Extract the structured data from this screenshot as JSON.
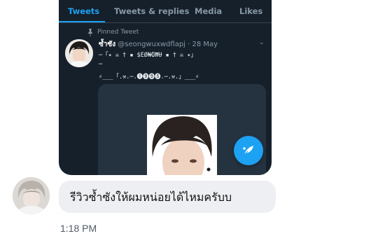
{
  "screenshot": {
    "tabs": [
      {
        "label": "Tweets",
        "active": true
      },
      {
        "label": "Tweets & replies",
        "active": false
      },
      {
        "label": "Media",
        "active": false
      },
      {
        "label": "Likes",
        "active": false
      }
    ],
    "pinned_label": "Pinned Tweet",
    "tweet": {
      "author_name": "ซ้ำซัง",
      "handle": "@seongwuxwdflapj",
      "time": "· 28 May",
      "text_lines": [
        "─「✦ ☠ † ▪ $ЕØ₦₲₩Ʉ ▪ † ☠ ✦」",
        "─",
        "⚡___「.⚒.─.❶❾❾❺.─.⚒.」___⚡"
      ]
    },
    "accent_color": "#1da1f2",
    "background_color": "#15202b",
    "icons": [
      "pin-icon",
      "chevron-down-icon",
      "compose-tweet-icon"
    ]
  },
  "message": {
    "text": "รีวิวซ้ำซังให้ผมหน่อยได้ไหมครับบ",
    "time": "1:18 PM",
    "bubble_color": "#eeeff2"
  }
}
